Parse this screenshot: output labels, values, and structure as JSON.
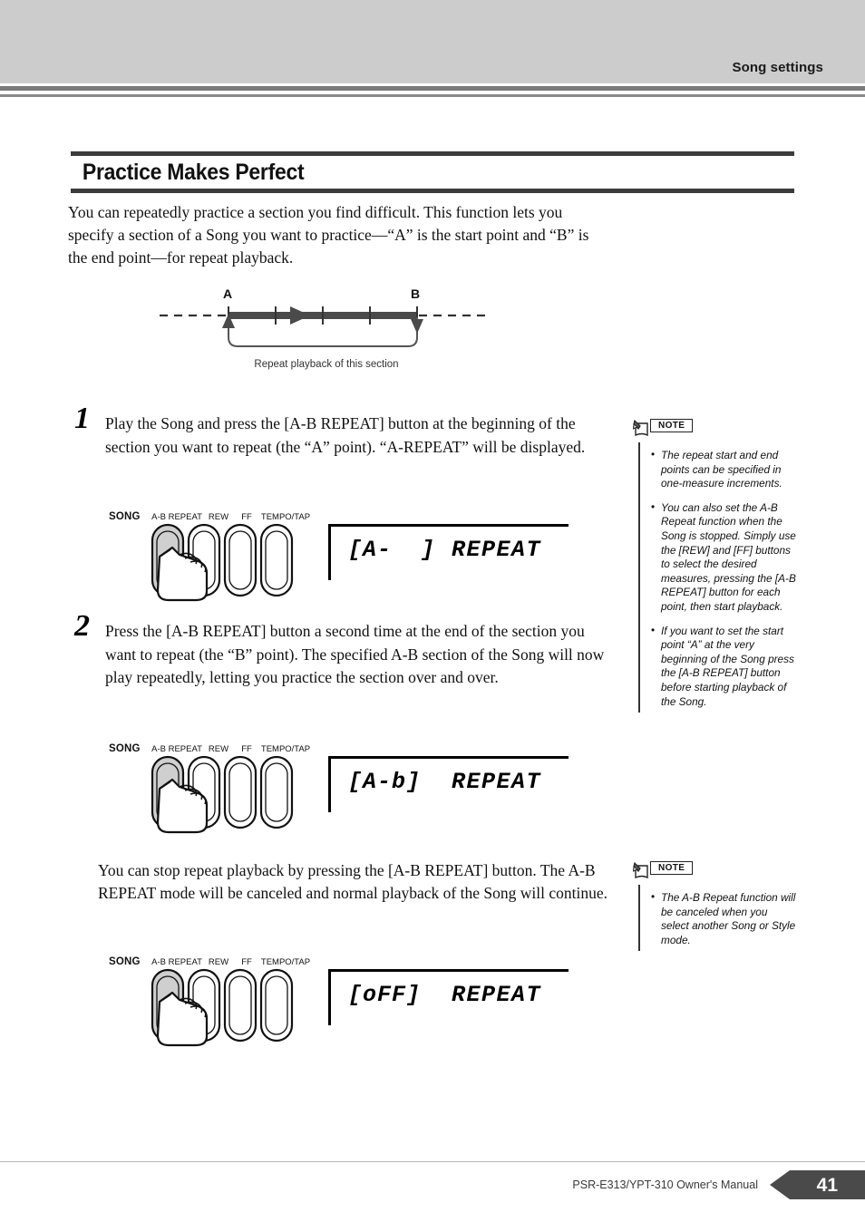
{
  "header": {
    "title": "Song settings"
  },
  "section": {
    "title": "Practice Makes Perfect"
  },
  "intro": "You can repeatedly practice a section you find difficult. This function lets you specify a section of a Song you want to practice—“A” is the start point and “B” is the end point—for repeat playback.",
  "diagram": {
    "label_a": "A",
    "label_b": "B",
    "caption": "Repeat playback of this section"
  },
  "steps": [
    {
      "number": "1",
      "text": "Play the Song and press the [A-B REPEAT] button at the beginning of the section you want to repeat (the “A” point). “A-REPEAT” will be displayed."
    },
    {
      "number": "2",
      "text": "Press the [A-B REPEAT] button a second time at the end of the section you want to repeat (the “B” point). The specified A-B section of the Song will now play repeatedly, letting you practice the section over and over."
    }
  ],
  "closing_paragraph": "You can stop repeat playback by pressing the [A-B REPEAT] button. The A-B REPEAT mode will be canceled and normal playback of the Song will continue.",
  "panel": {
    "group_label": "SONG",
    "buttons": [
      {
        "label": "A-B REPEAT",
        "pressed": true
      },
      {
        "label": "REW",
        "pressed": false
      },
      {
        "label": "FF",
        "pressed": false
      },
      {
        "label": "TEMPO/TAP",
        "pressed": false
      }
    ]
  },
  "displays": [
    {
      "value": "[A-  ]",
      "indicator": "REPEAT"
    },
    {
      "value": "[A-b]",
      "indicator": "REPEAT"
    },
    {
      "value": "[oFF]",
      "indicator": "REPEAT"
    }
  ],
  "notes": [
    {
      "tag": "NOTE",
      "items": [
        "The repeat start and end points can be specified in one-measure increments.",
        "You can also set the A-B Repeat function when the Song is stopped. Simply use the [REW] and [FF] buttons to select the desired measures, pressing the [A-B REPEAT] button for each point, then start playback.",
        "If you want to set the start point “A” at the very beginning of the Song press the [A-B REPEAT] button before starting playback of the Song."
      ]
    },
    {
      "tag": "NOTE",
      "items": [
        "The A-B Repeat function will be canceled when you select another Song or Style mode."
      ]
    }
  ],
  "footer": {
    "text": "PSR-E313/YPT-310   Owner's Manual",
    "page_number": "41"
  },
  "colors": {
    "header_band": "#cccccc",
    "rule": "#7a7a7a",
    "section_bar": "#3c3c3c",
    "page_tab": "#4a4a4a"
  }
}
